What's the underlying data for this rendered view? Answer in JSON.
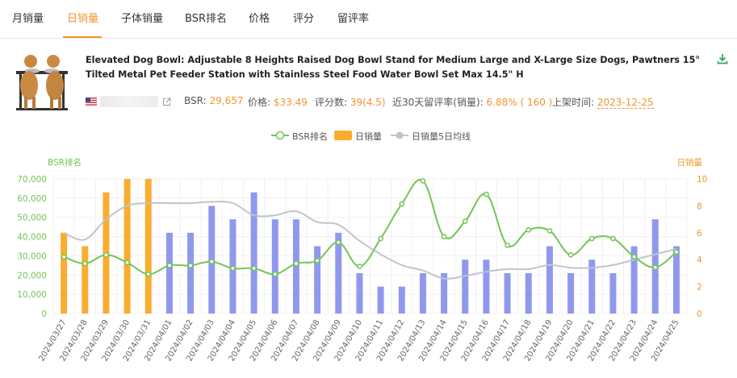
{
  "tabs": [
    {
      "label": "月销量",
      "active": false
    },
    {
      "label": "日销量",
      "active": true
    },
    {
      "label": "子体销量",
      "active": false
    },
    {
      "label": "BSR排名",
      "active": false
    },
    {
      "label": "价格",
      "active": false
    },
    {
      "label": "评分",
      "active": false
    },
    {
      "label": "留评率",
      "active": false
    }
  ],
  "product": {
    "title": "Elevated Dog Bowl: Adjustable 8 Heights Raised Dog Bowl Stand for Medium Large and X-Large Size Dogs, Pawtners 15° Tilted Metal Pet Feeder Station with Stainless Steel Food Water Bowl Set Max 14.5\" H",
    "bsr_label": "BSR:",
    "bsr_value": "29,657",
    "price_label": "价格:",
    "price_value": "$33.49",
    "rating_label": "评分数:",
    "rating_value": "39(4.5)",
    "review_rate_label": "近30天留评率(销量):",
    "review_rate_value": "6.88% ( 160 )",
    "listed_label": "上架时间:",
    "listed_value": "2023-12-25"
  },
  "icons": {
    "download": "download-icon",
    "external_link": "external-link-icon",
    "flag": "us-flag-icon"
  },
  "colors": {
    "accent": "#f0962d",
    "bsr_line": "#72c555",
    "sales_bar": "#f9ad2f",
    "sales_bar_estimated": "#9098ee",
    "avg_line": "#c1c4cb",
    "grid": "#f0f0f0"
  },
  "chart_data": {
    "type": "bar",
    "legend": [
      "BSR排名",
      "日销量",
      "日销量5日均线"
    ],
    "legend_position": "top-center",
    "grid": true,
    "y_left_label": "BSR排名",
    "y_right_label": "日销量",
    "y_left_ticks": [
      "0",
      "10,000",
      "20,000",
      "30,000",
      "40,000",
      "50,000",
      "60,000",
      "70,000"
    ],
    "y_right_ticks": [
      "0",
      "2",
      "4",
      "6",
      "8",
      "10"
    ],
    "y_left_range": [
      0,
      70000
    ],
    "y_right_range": [
      0,
      10
    ],
    "categories": [
      "2024/03/27",
      "2024/03/28",
      "2024/03/29",
      "2024/03/30",
      "2024/03/31",
      "2024/04/01",
      "2024/04/02",
      "2024/04/03",
      "2024/04/04",
      "2024/04/05",
      "2024/04/06",
      "2024/04/07",
      "2024/04/08",
      "2024/04/09",
      "2024/04/10",
      "2024/04/11",
      "2024/04/12",
      "2024/04/13",
      "2024/04/14",
      "2024/04/15",
      "2024/04/16",
      "2024/04/17",
      "2024/04/18",
      "2024/04/19",
      "2024/04/20",
      "2024/04/21",
      "2024/04/22",
      "2024/04/23",
      "2024/04/24",
      "2024/04/25"
    ],
    "series": [
      {
        "name": "日销量",
        "axis": "right",
        "values": [
          6,
          5,
          9,
          10,
          10,
          6,
          6,
          8,
          7,
          9,
          7,
          7,
          5,
          6,
          3,
          2,
          2,
          3,
          3,
          4,
          4,
          3,
          3,
          5,
          3,
          4,
          3,
          5,
          7,
          5
        ],
        "colored_first": 5
      },
      {
        "name": "BSR排名",
        "axis": "left",
        "values": [
          29500,
          26000,
          30500,
          26500,
          20500,
          25000,
          25000,
          27000,
          23500,
          23500,
          20500,
          26000,
          27500,
          37000,
          24500,
          39000,
          57000,
          69000,
          40000,
          48000,
          62000,
          35500,
          43500,
          43000,
          30500,
          39000,
          39000,
          29500,
          24000,
          32000
        ]
      },
      {
        "name": "日销量5日均线",
        "axis": "right",
        "values": [
          6,
          5.5,
          7,
          8,
          8.2,
          8.2,
          8.2,
          8.3,
          8.2,
          7.3,
          7.3,
          7.6,
          6.8,
          6.6,
          5.4,
          4.4,
          3.6,
          3.2,
          2.6,
          2.8,
          3.1,
          3.3,
          3.3,
          3.6,
          3.4,
          3.4,
          3.6,
          4.0,
          4.4,
          4.8
        ]
      }
    ]
  }
}
